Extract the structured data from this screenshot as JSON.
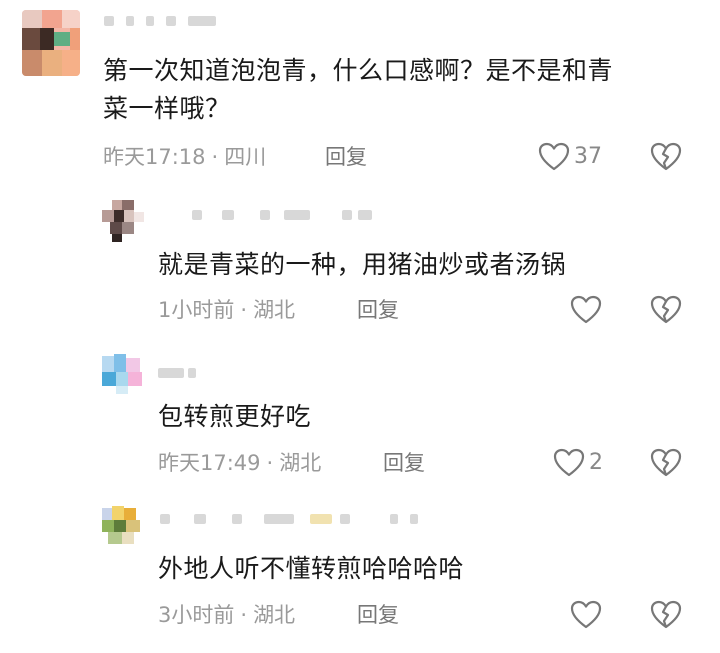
{
  "comments": [
    {
      "text_line1": "第一次知道泡泡青，什么口感啊？是不是和青",
      "text_line2": "菜一样哦？",
      "time": "昨天17:18",
      "separator": "·",
      "location": "四川",
      "reply_label": "回复",
      "like_count": "37"
    }
  ],
  "replies": [
    {
      "text": "就是青菜的一种，用猪油炒或者汤锅",
      "time": "1小时前",
      "separator": "·",
      "location": "湖北",
      "reply_label": "回复",
      "like_count": ""
    },
    {
      "text": "包转煎更好吃",
      "time": "昨天17:49",
      "separator": "·",
      "location": "湖北",
      "reply_label": "回复",
      "like_count": "2"
    },
    {
      "text": "外地人听不懂转煎哈哈哈哈",
      "time": "3小时前",
      "separator": "·",
      "location": "湖北",
      "reply_label": "回复",
      "like_count": ""
    }
  ],
  "icons": {
    "like": "heart-outline-icon",
    "dislike": "broken-heart-icon"
  },
  "colors": {
    "text": "#1a1a1a",
    "meta": "#9a9a9a",
    "icon": "#777777"
  }
}
